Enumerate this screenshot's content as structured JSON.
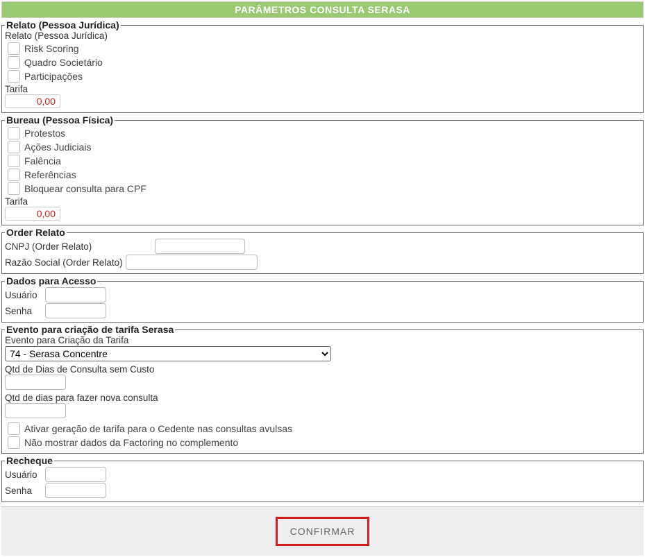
{
  "header": {
    "title": "PARÂMETROS CONSULTA SERASA"
  },
  "relato": {
    "legend": "Relato (Pessoa Jurídica)",
    "sub": "Relato (Pessoa Jurídica)",
    "risk_scoring": "Risk Scoring",
    "quadro_societario": "Quadro Societário",
    "participacoes": "Participações",
    "tarifa_label": "Tarifa",
    "tarifa_value": "0,00"
  },
  "bureau": {
    "legend": "Bureau (Pessoa Física)",
    "protestos": "Protestos",
    "acoes": "Ações Judiciais",
    "falencia": "Falência",
    "referencias": "Referências",
    "bloquear_cpf": "Bloquear consulta para CPF",
    "tarifa_label": "Tarifa",
    "tarifa_value": "0,00"
  },
  "order_relato": {
    "legend": "Order Relato",
    "cnpj_label": "CNPJ (Order Relato)",
    "razao_label": "Razão Social (Order Relato)"
  },
  "acesso": {
    "legend": "Dados para Acesso",
    "usuario_label": "Usuário",
    "senha_label": "Senha"
  },
  "evento": {
    "legend": "Evento para criação de tarifa Serasa",
    "sub": "Evento para Criação da Tarifa",
    "select_value": "74 - Serasa Concentre",
    "qtd_sem_custo_label": "Qtd de Dias de Consulta sem Custo",
    "qtd_nova_label": "Qtd de dias para fazer nova consulta",
    "ativar_tarifa": "Ativar geração de tarifa para o Cedente nas consultas avulsas",
    "nao_mostrar": "Não mostrar dados da Factoring no complemento"
  },
  "recheque": {
    "legend": "Recheque",
    "usuario_label": "Usuário",
    "senha_label": "Senha"
  },
  "confirm": "CONFIRMAR"
}
